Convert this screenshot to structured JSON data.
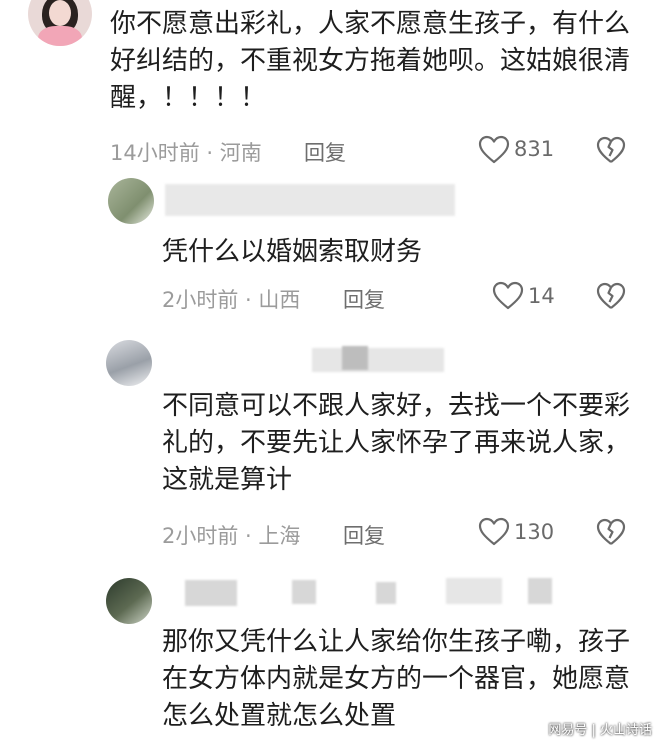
{
  "comments": [
    {
      "text": "你不愿意出彩礼，人家不愿意生孩子，有什么好纠结的，不重视女方拖着她呗。这姑娘很清醒，！！！！",
      "meta": "14小时前 · 河南",
      "reply_label": "回复",
      "likes": "831",
      "is_reply": false
    },
    {
      "text": "凭什么以婚姻索取财务",
      "meta": "2小时前 · 山西",
      "reply_label": "回复",
      "likes": "14",
      "is_reply": true
    },
    {
      "text": "不同意可以不跟人家好，去找一个不要彩礼的，不要先让人家怀孕了再来说人家，这就是算计",
      "meta": "2小时前 · 上海",
      "reply_label": "回复",
      "likes": "130",
      "is_reply": true
    },
    {
      "text": "那你又凭什么让人家给你生孩子嘞，孩子在女方体内就是女方的一个器官，她愿意怎么处置就怎么处置",
      "is_reply": true
    }
  ],
  "watermark": "网易号 | 火山诗话",
  "icons": {
    "like": "heart-outline-icon",
    "dislike": "broken-heart-icon"
  },
  "colors": {
    "text": "#1e1e1e",
    "meta": "#9b9b9b",
    "icon": "#6a6a6a"
  }
}
